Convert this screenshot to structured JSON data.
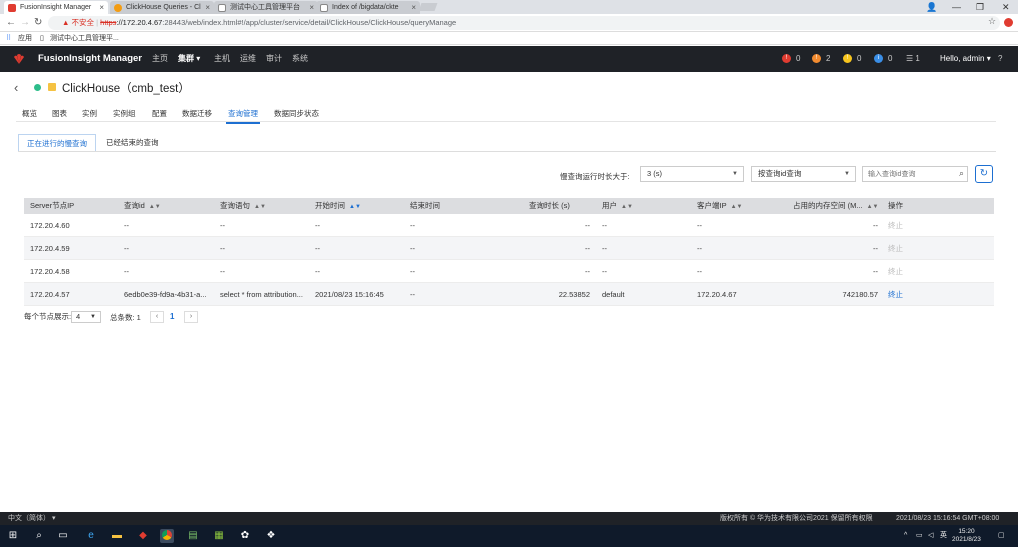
{
  "browser": {
    "tabs": [
      {
        "label": "FusionInsight Manager",
        "color": "#e03c31"
      },
      {
        "label": "ClickHouse Queries - Cl",
        "color": "#f39c12"
      },
      {
        "label": "测试中心工具管理平台",
        "color": "#888888"
      },
      {
        "label": "Index of /bigdata/ckte",
        "color": "#888888"
      }
    ],
    "security_warning": "不安全",
    "url_scheme": "https",
    "url_host": "://172.20.4.67",
    "url_path": ":28443/web/index.html#!/app/cluster/service/detail/ClickHouse/ClickHouse/queryManage",
    "bookmarks": {
      "apps": "应用",
      "item1": "测试中心工具管理平..."
    }
  },
  "header": {
    "brand": "FusionInsight Manager",
    "menu": [
      "主页",
      "集群",
      "主机",
      "运维",
      "审计",
      "系统"
    ],
    "active_menu": "集群",
    "alarms": [
      {
        "count": "0",
        "color": "#e03c31"
      },
      {
        "count": "2",
        "color": "#f28b30"
      },
      {
        "count": "0",
        "color": "#f7c51e"
      },
      {
        "count": "0",
        "color": "#3a8ee6"
      }
    ],
    "tasks": "1",
    "user": "Hello, admin",
    "help": "?"
  },
  "page": {
    "title": "ClickHouse（cmb_test）",
    "subtabs": [
      "概览",
      "图表",
      "实例",
      "实例组",
      "配置",
      "数据迁移",
      "查询管理",
      "数据同步状态"
    ],
    "active_subtab": "查询管理",
    "query_tabs": [
      "正在进行的慢查询",
      "已经结束的查询"
    ],
    "active_query_tab": "正在进行的慢查询"
  },
  "filters": {
    "duration_label": "慢查询运行时长大于:",
    "duration_value": "3 (s)",
    "search_type": "按查询id查询",
    "search_placeholder": "输入查询id查询"
  },
  "table": {
    "columns": [
      "Server节点IP",
      "查询id",
      "查询语句",
      "开始时间",
      "结束时间",
      "查询时长 (s)",
      "用户",
      "客户端IP",
      "占用的内存空间 (M...",
      "操作"
    ],
    "rows": [
      {
        "ip": "172.20.4.60",
        "qid": "--",
        "sql": "--",
        "start": "--",
        "end": "--",
        "dur": "--",
        "user": "--",
        "client": "--",
        "mem": "--",
        "op": "终止",
        "op_enabled": false
      },
      {
        "ip": "172.20.4.59",
        "qid": "--",
        "sql": "--",
        "start": "--",
        "end": "--",
        "dur": "--",
        "user": "--",
        "client": "--",
        "mem": "--",
        "op": "终止",
        "op_enabled": false
      },
      {
        "ip": "172.20.4.58",
        "qid": "--",
        "sql": "--",
        "start": "--",
        "end": "--",
        "dur": "--",
        "user": "--",
        "client": "--",
        "mem": "--",
        "op": "终止",
        "op_enabled": false
      },
      {
        "ip": "172.20.4.57",
        "qid": "6edb0e39-fd9a-4b31-a...",
        "sql": "select * from attribution...",
        "start": "2021/08/23 15:16:45",
        "end": "--",
        "dur": "22.53852",
        "user": "default",
        "client": "172.20.4.67",
        "mem": "742180.57",
        "op": "终止",
        "op_enabled": true
      }
    ]
  },
  "pagination": {
    "per_node_label": "每个节点展示:",
    "per_node_value": "4",
    "total_label": "总条数: 1",
    "current_page": "1"
  },
  "footer": {
    "language": "中文（简体）",
    "copyright": "版权所有 © 华为技术有限公司2021 保留所有权限",
    "time": "2021/08/23 15:16:54 GMT+08:00"
  },
  "taskbar": {
    "ime": "英",
    "clock_time": "15:20",
    "clock_date": "2021/8/23"
  }
}
